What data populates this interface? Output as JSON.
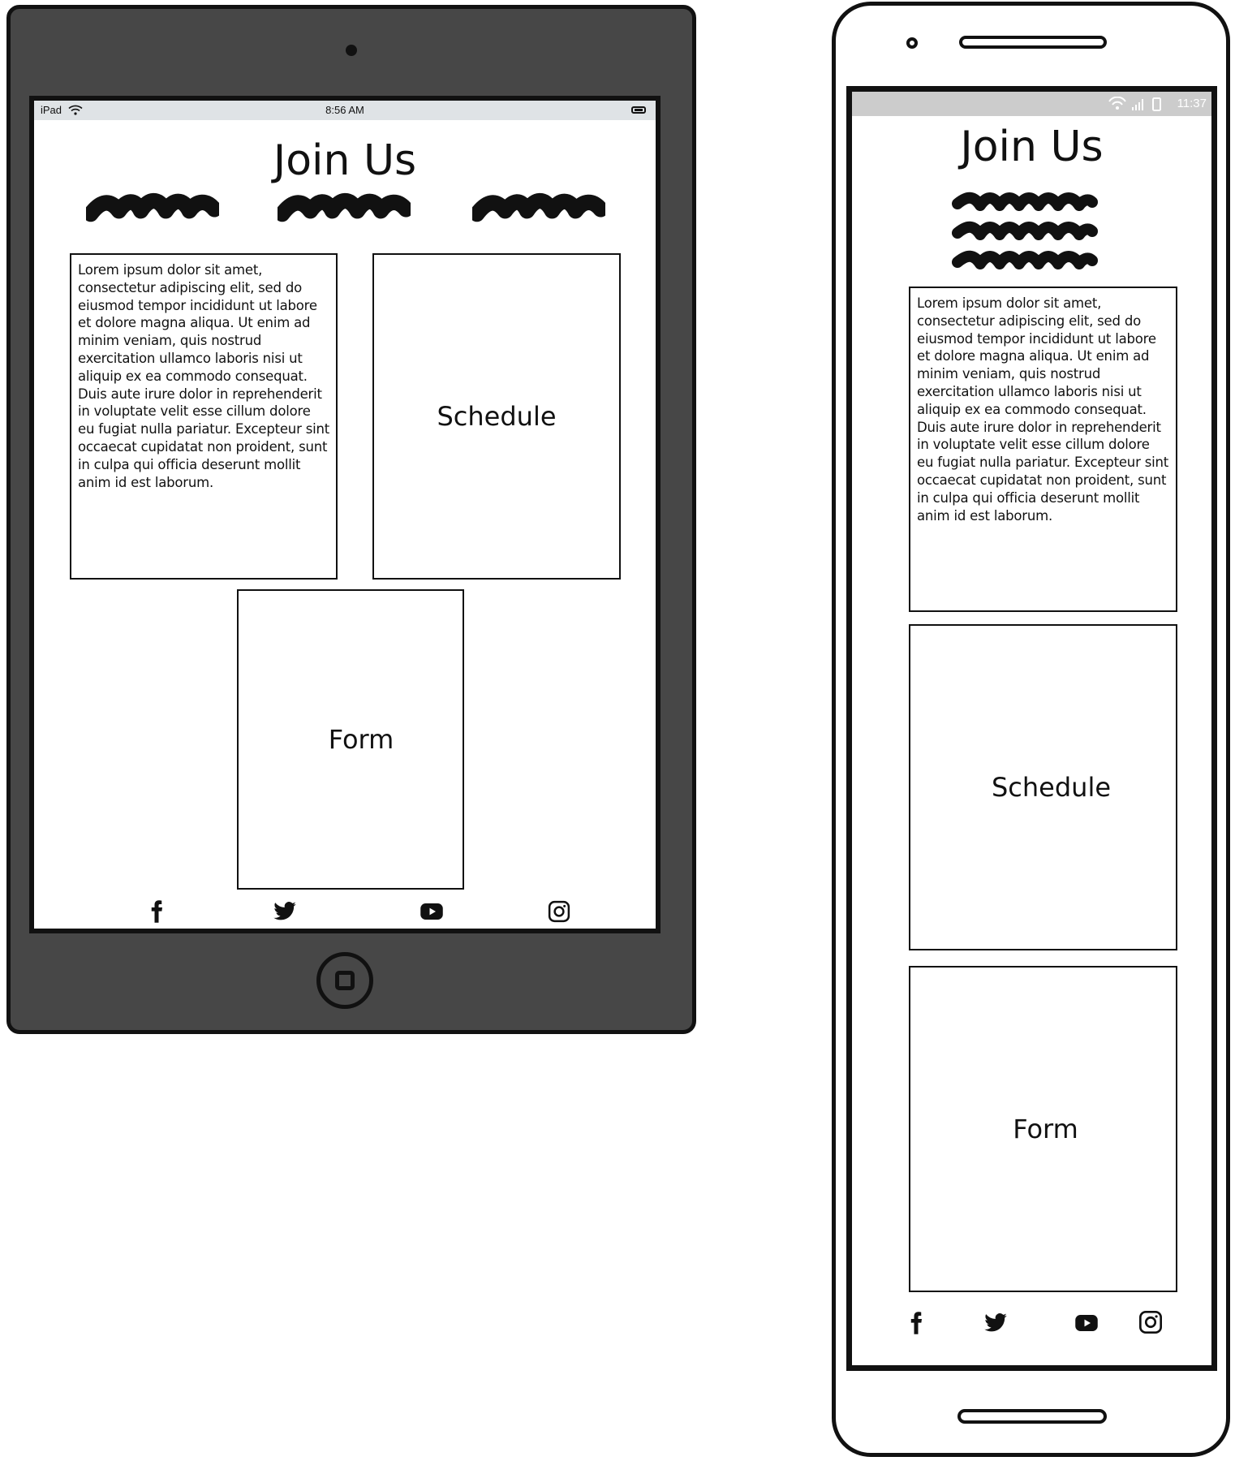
{
  "tablet": {
    "status_bar": {
      "device": "iPad",
      "time": "8:56 AM"
    },
    "title": "Join Us",
    "intro_text": "Lorem ipsum dolor sit amet, consectetur adipiscing elit, sed do eiusmod tempor incididunt ut labore et dolore magna aliqua. Ut enim ad minim veniam, quis nostrud exercitation ullamco laboris nisi ut aliquip ex ea commodo consequat. Duis aute irure dolor in reprehenderit in voluptate velit esse cillum dolore eu fugiat nulla pariatur. Excepteur sint occaecat cupidatat non proident, sunt in culpa qui officia deserunt mollit anim id est laborum.",
    "schedule_label": "Schedule",
    "form_label": "Form",
    "social_icons": [
      "facebook-icon",
      "twitter-icon",
      "youtube-icon",
      "instagram-icon"
    ]
  },
  "phone": {
    "status_bar": {
      "time": "11:37"
    },
    "title": "Join Us",
    "intro_text": "Lorem ipsum dolor sit amet, consectetur adipiscing elit, sed do eiusmod tempor incididunt ut labore et dolore magna aliqua. Ut enim ad minim veniam, quis nostrud exercitation ullamco laboris nisi ut aliquip ex ea commodo consequat. Duis aute irure dolor in reprehenderit in voluptate velit esse cillum dolore eu fugiat nulla pariatur. Excepteur sint occaecat cupidatat non proident, sunt in culpa qui officia deserunt mollit anim id est laborum.",
    "schedule_label": "Schedule",
    "form_label": "Form",
    "social_icons": [
      "facebook-icon",
      "twitter-icon",
      "youtube-icon",
      "instagram-icon"
    ]
  },
  "colors": {
    "device_frame": "#474747",
    "ink": "#111111",
    "ios_status_bar": "#dfe3e6",
    "android_status_bar": "#cccccc"
  }
}
